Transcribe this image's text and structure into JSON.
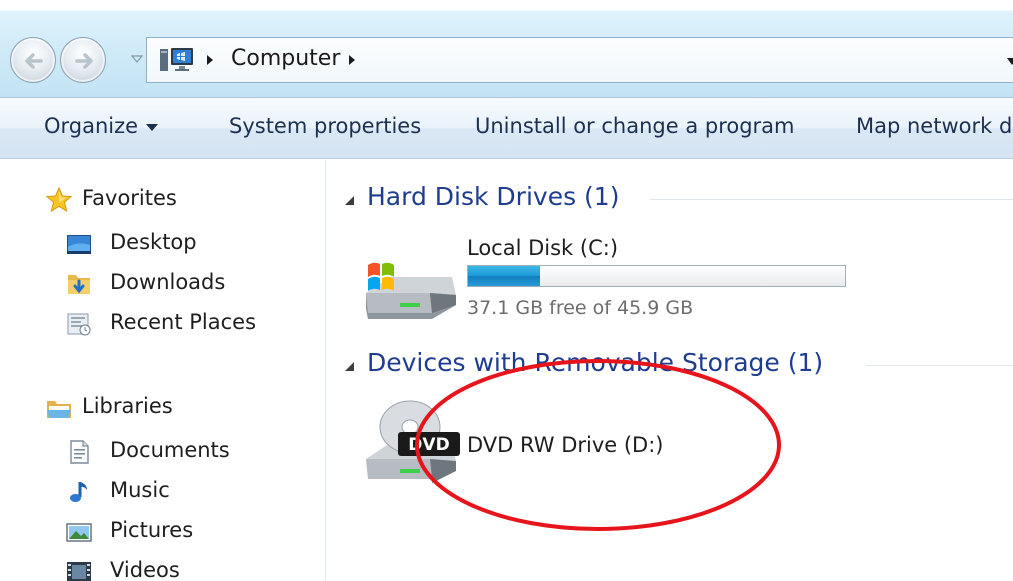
{
  "address_bar": {
    "path": [
      "Computer"
    ],
    "icons": {
      "back": "back-arrow-icon",
      "forward": "forward-arrow-icon",
      "location": "computer-icon",
      "dropdown": "chevron-down-icon"
    }
  },
  "toolbar": {
    "organize_label": "Organize",
    "system_properties_label": "System properties",
    "uninstall_label": "Uninstall or change a program",
    "map_drive_label": "Map network d"
  },
  "navigation": {
    "favorites": {
      "label": "Favorites",
      "icon": "star-icon",
      "items": [
        {
          "label": "Desktop",
          "icon": "desktop-icon"
        },
        {
          "label": "Downloads",
          "icon": "downloads-folder-icon"
        },
        {
          "label": "Recent Places",
          "icon": "recent-places-icon"
        }
      ]
    },
    "libraries": {
      "label": "Libraries",
      "icon": "libraries-icon",
      "items": [
        {
          "label": "Documents",
          "icon": "document-icon"
        },
        {
          "label": "Music",
          "icon": "music-note-icon"
        },
        {
          "label": "Pictures",
          "icon": "pictures-icon"
        },
        {
          "label": "Videos",
          "icon": "film-icon"
        }
      ]
    }
  },
  "content": {
    "groups": [
      {
        "header": "Hard Disk Drives (1)",
        "drives": [
          {
            "name": "Local Disk (C:)",
            "free_text": "37.1 GB free of 45.9 GB",
            "used_fraction": 0.192,
            "icon": "hard-drive-icon"
          }
        ]
      },
      {
        "header": "Devices with Removable Storage (1)",
        "drives": [
          {
            "name": "DVD RW Drive (D:)",
            "icon": "dvd-drive-icon",
            "icon_label": "DVD"
          }
        ]
      }
    ]
  },
  "colors": {
    "group_header": "#1e3d8f",
    "capacity_fill": "#1e9bd7",
    "annotation": "#e8141b"
  }
}
